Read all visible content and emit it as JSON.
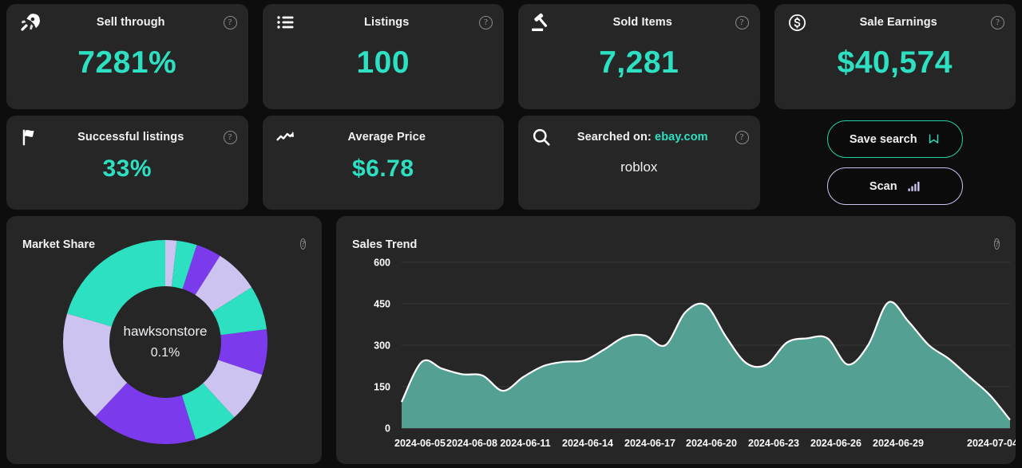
{
  "theme": {
    "page_bg": "#0d0d0d",
    "card_bg": "#262626",
    "accent_teal": "#2de0c2",
    "accent_purple": "#7c3aed",
    "accent_lavender": "#cdc3f0",
    "area_fill": "#54a193",
    "area_line": "#ffffff"
  },
  "kpis_row1": [
    {
      "icon": "rocket-icon",
      "title": "Sell through",
      "value": "7281%",
      "help": "?"
    },
    {
      "icon": "list-icon",
      "title": "Listings",
      "value": "100",
      "help": "?"
    },
    {
      "icon": "gavel-icon",
      "title": "Sold Items",
      "value": "7,281",
      "help": "?"
    },
    {
      "icon": "dollar-circle-icon",
      "title": "Sale Earnings",
      "value": "$40,574",
      "help": "?"
    }
  ],
  "kpis_row2": [
    {
      "icon": "flag-icon",
      "title": "Successful listings",
      "value": "33%",
      "help": "?"
    },
    {
      "icon": "trend-icon",
      "title": "Average Price",
      "value": "$6.78",
      "help": ""
    }
  ],
  "search_card": {
    "icon": "search-icon",
    "label": "Searched on:",
    "site": "ebay.com",
    "query": "roblox",
    "help": "?"
  },
  "actions": {
    "save_label": "Save search",
    "save_icon": "bookmark-icon",
    "scan_label": "Scan",
    "scan_icon": "bars-icon"
  },
  "market_share": {
    "title": "Market Share",
    "help": "?",
    "center_name": "hawksonstore",
    "center_value": "0.1%"
  },
  "sales_trend": {
    "title": "Sales Trend",
    "help": "?"
  },
  "chart_data": [
    {
      "type": "pie",
      "title": "Market Share",
      "center_label": "hawksonstore",
      "center_value": "0.1%",
      "donut": true,
      "legend": "none",
      "categories": [
        "seg-1",
        "seg-2",
        "seg-3",
        "seg-4",
        "seg-5",
        "seg-6",
        "seg-7",
        "seg-8",
        "seg-9",
        "seg-10",
        "seg-11"
      ],
      "values": [
        1.8,
        3.2,
        4.0,
        7.0,
        7.0,
        7.2,
        8.0,
        7.0,
        16.8,
        17.5,
        20.5
      ],
      "colors": [
        "#cdc3f0",
        "#2de0c2",
        "#7c3aed",
        "#cdc3f0",
        "#2de0c2",
        "#7c3aed",
        "#cdc3f0",
        "#2de0c2",
        "#7c3aed",
        "#cdc3f0",
        "#2de0c2"
      ]
    },
    {
      "type": "area",
      "title": "Sales Trend",
      "xlabel": "",
      "ylabel": "",
      "ylim": [
        0,
        600
      ],
      "yticks": [
        0,
        150,
        300,
        450,
        600
      ],
      "grid": true,
      "xticks": [
        "2024-06-05",
        "2024-06-08",
        "2024-06-11",
        "2024-06-14",
        "2024-06-17",
        "2024-06-20",
        "2024-06-23",
        "2024-06-26",
        "2024-06-29",
        "2024-07-04"
      ],
      "x": [
        "2024-06-04",
        "2024-06-05",
        "2024-06-06",
        "2024-06-07",
        "2024-06-08",
        "2024-06-09",
        "2024-06-10",
        "2024-06-11",
        "2024-06-12",
        "2024-06-13",
        "2024-06-14",
        "2024-06-15",
        "2024-06-16",
        "2024-06-17",
        "2024-06-18",
        "2024-06-19",
        "2024-06-20",
        "2024-06-21",
        "2024-06-22",
        "2024-06-23",
        "2024-06-24",
        "2024-06-25",
        "2024-06-26",
        "2024-06-27",
        "2024-06-28",
        "2024-06-29",
        "2024-06-30",
        "2024-07-01",
        "2024-07-02",
        "2024-07-03",
        "2024-07-04"
      ],
      "values": [
        95,
        240,
        215,
        195,
        190,
        135,
        185,
        225,
        240,
        245,
        285,
        330,
        335,
        300,
        420,
        445,
        330,
        235,
        230,
        310,
        325,
        325,
        230,
        300,
        455,
        385,
        300,
        250,
        185,
        120,
        30
      ],
      "series": [
        {
          "name": "Sales",
          "values": [
            95,
            240,
            215,
            195,
            190,
            135,
            185,
            225,
            240,
            245,
            285,
            330,
            335,
            300,
            420,
            445,
            330,
            235,
            230,
            310,
            325,
            325,
            230,
            300,
            455,
            385,
            300,
            250,
            185,
            120,
            30
          ]
        }
      ]
    }
  ]
}
